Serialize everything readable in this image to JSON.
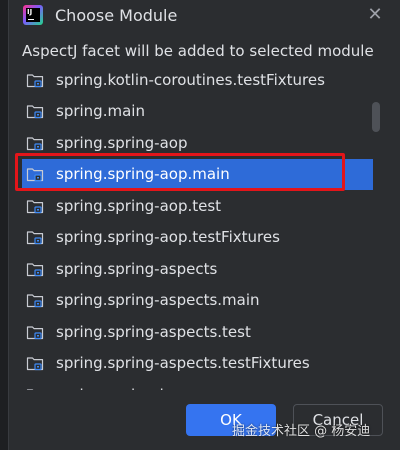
{
  "dialog": {
    "title": "Choose Module",
    "app_icon": "intellij-idea-icon",
    "close_icon": "close-icon",
    "message": "AspectJ facet will be added to selected module"
  },
  "modules": [
    {
      "label": "spring.kotlin-coroutines.testFixtures",
      "selected": false
    },
    {
      "label": "spring.main",
      "selected": false
    },
    {
      "label": "spring.spring-aop",
      "selected": false
    },
    {
      "label": "spring.spring-aop.main",
      "selected": true
    },
    {
      "label": "spring.spring-aop.test",
      "selected": false
    },
    {
      "label": "spring.spring-aop.testFixtures",
      "selected": false
    },
    {
      "label": "spring.spring-aspects",
      "selected": false
    },
    {
      "label": "spring.spring-aspects.main",
      "selected": false
    },
    {
      "label": "spring.spring-aspects.test",
      "selected": false
    },
    {
      "label": "spring.spring-aspects.testFixtures",
      "selected": false
    },
    {
      "label": "spring.spring-beans",
      "selected": false
    }
  ],
  "buttons": {
    "ok": "OK",
    "cancel": "Cancel"
  },
  "watermark": "掘金技术社区 @ 杨安迪",
  "colors": {
    "background": "#2b2d30",
    "selection": "#2e6bd8",
    "ok_button": "#3574f0",
    "highlight_box": "#e3151a",
    "text": "#dfe1e5"
  }
}
